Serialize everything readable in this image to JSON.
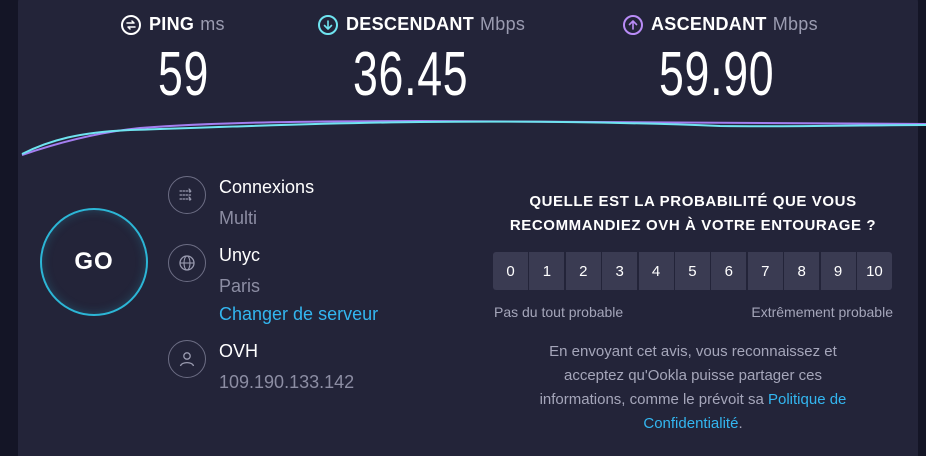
{
  "metrics": {
    "ping": {
      "label": "PING",
      "unit": "ms",
      "value": "59",
      "icon": "ping-icon"
    },
    "download": {
      "label": "DESCENDANT",
      "unit": "Mbps",
      "value": "36.45",
      "icon": "download-arrow-icon",
      "color": "#6fe4f0"
    },
    "upload": {
      "label": "ASCENDANT",
      "unit": "Mbps",
      "value": "59.90",
      "icon": "upload-arrow-icon",
      "color": "#b98cf7"
    }
  },
  "go_button": {
    "label": "GO"
  },
  "connections": {
    "label": "Connexions",
    "value": "Multi",
    "icon": "connections-icon"
  },
  "server": {
    "name": "Unyc",
    "location": "Paris",
    "change_label": "Changer de serveur",
    "icon": "globe-icon"
  },
  "isp": {
    "name": "OVH",
    "ip": "109.190.133.142",
    "icon": "user-icon"
  },
  "survey": {
    "title_line1": "QUELLE EST LA PROBABILITÉ QUE VOUS",
    "title_line2": "RECOMMANDIEZ OVH À VOTRE ENTOURAGE ?",
    "scale": [
      "0",
      "1",
      "2",
      "3",
      "4",
      "5",
      "6",
      "7",
      "8",
      "9",
      "10"
    ],
    "low_label": "Pas du tout probable",
    "high_label": "Extrêmement probable",
    "consent_line1": "En envoyant cet avis, vous reconnaissez et",
    "consent_line2": "acceptez qu'Ookla puisse partager ces",
    "consent_line3_prefix": "informations, comme le prévoit sa ",
    "consent_link_part1": "Politique de",
    "consent_link_part2": "Confidentialité",
    "consent_suffix": "."
  },
  "colors": {
    "background": "#141526",
    "panel": "#232439",
    "accent_link": "#33b6f0",
    "go_ring": "#2cb6d6"
  }
}
